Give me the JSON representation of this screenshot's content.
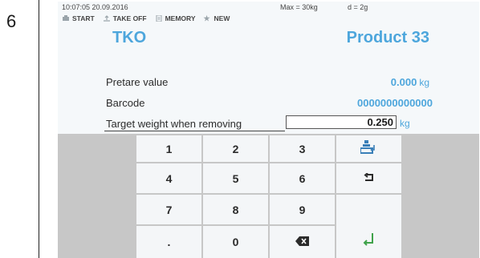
{
  "step": {
    "number": "6"
  },
  "status_bar": {
    "datetime": "10:07:05 20.09.2016",
    "max": "Max = 30kg",
    "division": "d = 2g"
  },
  "toolbar": {
    "items": [
      {
        "label": "START",
        "icon": "scale-icon"
      },
      {
        "label": "TAKE OFF",
        "icon": "tare-icon"
      },
      {
        "label": "MEMORY",
        "icon": "memory-icon"
      },
      {
        "label": "NEW",
        "icon": "star-icon"
      }
    ]
  },
  "header": {
    "mode": "TKO",
    "product": "Product 33"
  },
  "fields": {
    "pretare": {
      "label": "Pretare value",
      "value": "0.000",
      "unit": "kg"
    },
    "barcode": {
      "label": "Barcode",
      "value": "0000000000000"
    },
    "target": {
      "label": "Target weight when removing",
      "value": "0.250",
      "unit": "kg"
    }
  },
  "keypad": {
    "keys": [
      "1",
      "2",
      "3",
      "4",
      "5",
      "6",
      "7",
      "8",
      "9",
      ".",
      "0"
    ],
    "icons": {
      "scale": "scale-load-icon",
      "undo": "undo-icon",
      "backspace": "backspace-icon",
      "enter": "enter-icon"
    }
  },
  "colors": {
    "accent": "#4da6dc",
    "keypad_bg": "#c7c7c7",
    "key_bg": "#f4f6f8",
    "screen_bg": "#f5f8fa"
  }
}
